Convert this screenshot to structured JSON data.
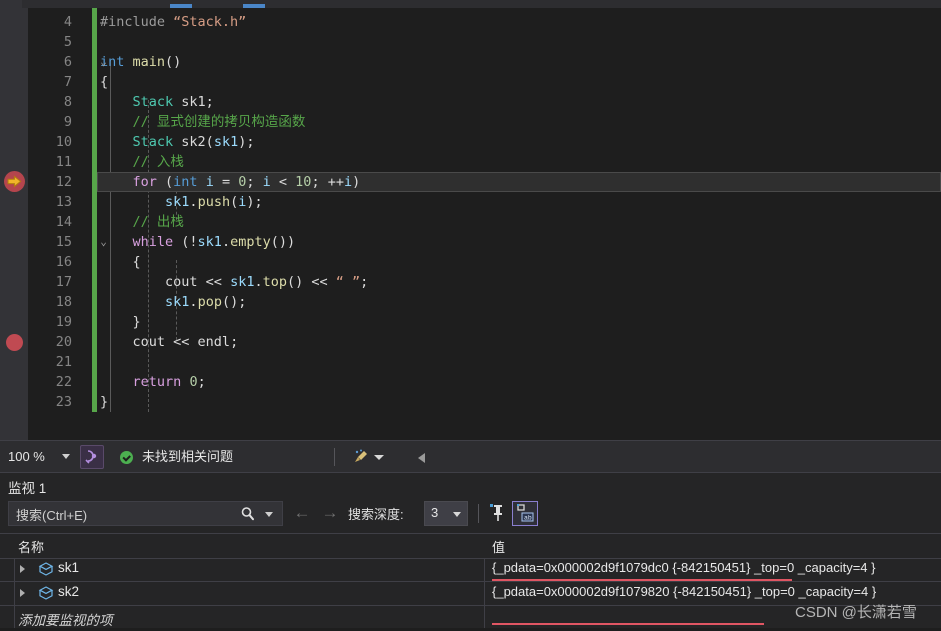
{
  "editor": {
    "lines": [
      {
        "num": "4",
        "tokens": [
          {
            "t": "#include ",
            "c": "pp"
          },
          {
            "t": "“Stack.h”",
            "c": "str"
          }
        ]
      },
      {
        "num": "5",
        "tokens": []
      },
      {
        "num": "6",
        "tokens": [
          {
            "t": "int",
            "c": "kw"
          },
          {
            "t": " ",
            "c": "pun"
          },
          {
            "t": "main",
            "c": "fn"
          },
          {
            "t": "()",
            "c": "pun"
          }
        ]
      },
      {
        "num": "7",
        "tokens": [
          {
            "t": "{",
            "c": "brace"
          }
        ]
      },
      {
        "num": "8",
        "tokens": [
          {
            "t": "    ",
            "c": "pun"
          },
          {
            "t": "Stack",
            "c": "type"
          },
          {
            "t": " sk1",
            "c": "pun"
          },
          {
            "t": ";",
            "c": "pun"
          }
        ]
      },
      {
        "num": "9",
        "tokens": [
          {
            "t": "    // 显式创建的拷贝构造函数",
            "c": "cmt"
          }
        ]
      },
      {
        "num": "10",
        "tokens": [
          {
            "t": "    ",
            "c": "pun"
          },
          {
            "t": "Stack",
            "c": "type"
          },
          {
            "t": " sk2",
            "c": "pun"
          },
          {
            "t": "(",
            "c": "pun"
          },
          {
            "t": "sk1",
            "c": "var"
          },
          {
            "t": ");",
            "c": "pun"
          }
        ]
      },
      {
        "num": "11",
        "tokens": [
          {
            "t": "    // 入栈",
            "c": "cmt"
          }
        ]
      },
      {
        "num": "12",
        "tokens": [
          {
            "t": "    ",
            "c": "pun"
          },
          {
            "t": "for",
            "c": "kw2"
          },
          {
            "t": " (",
            "c": "pun"
          },
          {
            "t": "int",
            "c": "kw"
          },
          {
            "t": " ",
            "c": "pun"
          },
          {
            "t": "i",
            "c": "var"
          },
          {
            "t": " = ",
            "c": "pun"
          },
          {
            "t": "0",
            "c": "num"
          },
          {
            "t": "; ",
            "c": "pun"
          },
          {
            "t": "i",
            "c": "var"
          },
          {
            "t": " < ",
            "c": "pun"
          },
          {
            "t": "10",
            "c": "num"
          },
          {
            "t": "; ++",
            "c": "pun"
          },
          {
            "t": "i",
            "c": "var"
          },
          {
            "t": ")",
            "c": "pun"
          }
        ]
      },
      {
        "num": "13",
        "tokens": [
          {
            "t": "        ",
            "c": "pun"
          },
          {
            "t": "sk1",
            "c": "var"
          },
          {
            "t": ".",
            "c": "pun"
          },
          {
            "t": "push",
            "c": "fn"
          },
          {
            "t": "(",
            "c": "pun"
          },
          {
            "t": "i",
            "c": "var"
          },
          {
            "t": ");",
            "c": "pun"
          }
        ]
      },
      {
        "num": "14",
        "tokens": [
          {
            "t": "    // 出栈",
            "c": "cmt"
          }
        ]
      },
      {
        "num": "15",
        "tokens": [
          {
            "t": "    ",
            "c": "pun"
          },
          {
            "t": "while",
            "c": "kw2"
          },
          {
            "t": " (!",
            "c": "pun"
          },
          {
            "t": "sk1",
            "c": "var"
          },
          {
            "t": ".",
            "c": "pun"
          },
          {
            "t": "empty",
            "c": "fn"
          },
          {
            "t": "())",
            "c": "pun"
          }
        ]
      },
      {
        "num": "16",
        "tokens": [
          {
            "t": "    {",
            "c": "brace"
          }
        ]
      },
      {
        "num": "17",
        "tokens": [
          {
            "t": "        ",
            "c": "pun"
          },
          {
            "t": "cout",
            "c": "pun"
          },
          {
            "t": " << ",
            "c": "pun"
          },
          {
            "t": "sk1",
            "c": "var"
          },
          {
            "t": ".",
            "c": "pun"
          },
          {
            "t": "top",
            "c": "fn"
          },
          {
            "t": "()",
            "c": "pun"
          },
          {
            "t": " << ",
            "c": "pun"
          },
          {
            "t": "“ ”",
            "c": "str"
          },
          {
            "t": ";",
            "c": "pun"
          }
        ]
      },
      {
        "num": "18",
        "tokens": [
          {
            "t": "        ",
            "c": "pun"
          },
          {
            "t": "sk1",
            "c": "var"
          },
          {
            "t": ".",
            "c": "pun"
          },
          {
            "t": "pop",
            "c": "fn"
          },
          {
            "t": "();",
            "c": "pun"
          }
        ]
      },
      {
        "num": "19",
        "tokens": [
          {
            "t": "    }",
            "c": "brace"
          }
        ]
      },
      {
        "num": "20",
        "tokens": [
          {
            "t": "    ",
            "c": "pun"
          },
          {
            "t": "cout",
            "c": "pun"
          },
          {
            "t": " << ",
            "c": "pun"
          },
          {
            "t": "endl",
            "c": "pun"
          },
          {
            "t": ";",
            "c": "pun"
          }
        ]
      },
      {
        "num": "21",
        "tokens": []
      },
      {
        "num": "22",
        "tokens": [
          {
            "t": "    ",
            "c": "pun"
          },
          {
            "t": "return",
            "c": "kw2"
          },
          {
            "t": " ",
            "c": "pun"
          },
          {
            "t": "0",
            "c": "num"
          },
          {
            "t": ";",
            "c": "pun"
          }
        ]
      },
      {
        "num": "23",
        "tokens": [
          {
            "t": "}",
            "c": "brace"
          }
        ]
      }
    ],
    "current_statement_line": "12",
    "breakpoint_lines": [
      "12",
      "20"
    ],
    "fold_lines": [
      "6",
      "15"
    ]
  },
  "statusbar": {
    "zoom": "100 %",
    "problems_text": "未找到相关问题"
  },
  "watch": {
    "title": "监视 1",
    "search_placeholder": "搜索(Ctrl+E)",
    "depth_label": "搜索深度:",
    "depth_value": "3",
    "columns": {
      "name": "名称",
      "value": "值"
    },
    "rows": [
      {
        "name": "sk1",
        "value": "{_pdata=0x000002d9f1079dc0 {-842150451} _top=0 _capacity=4 }"
      },
      {
        "name": "sk2",
        "value": "{_pdata=0x000002d9f1079820 {-842150451} _top=0 _capacity=4 }"
      }
    ],
    "add_item_text": "添加要监视的项"
  },
  "watermark": "CSDN @长潇若雪",
  "colors": {
    "editor_bg": "#1e1e1e",
    "panel_bg": "#252526",
    "chrome_bg": "#2d2d30",
    "changebar_green": "#57a64a",
    "breakpoint_red": "#c04a52",
    "annotation_red": "#e05663",
    "accent_purple": "#8a7fd0"
  }
}
